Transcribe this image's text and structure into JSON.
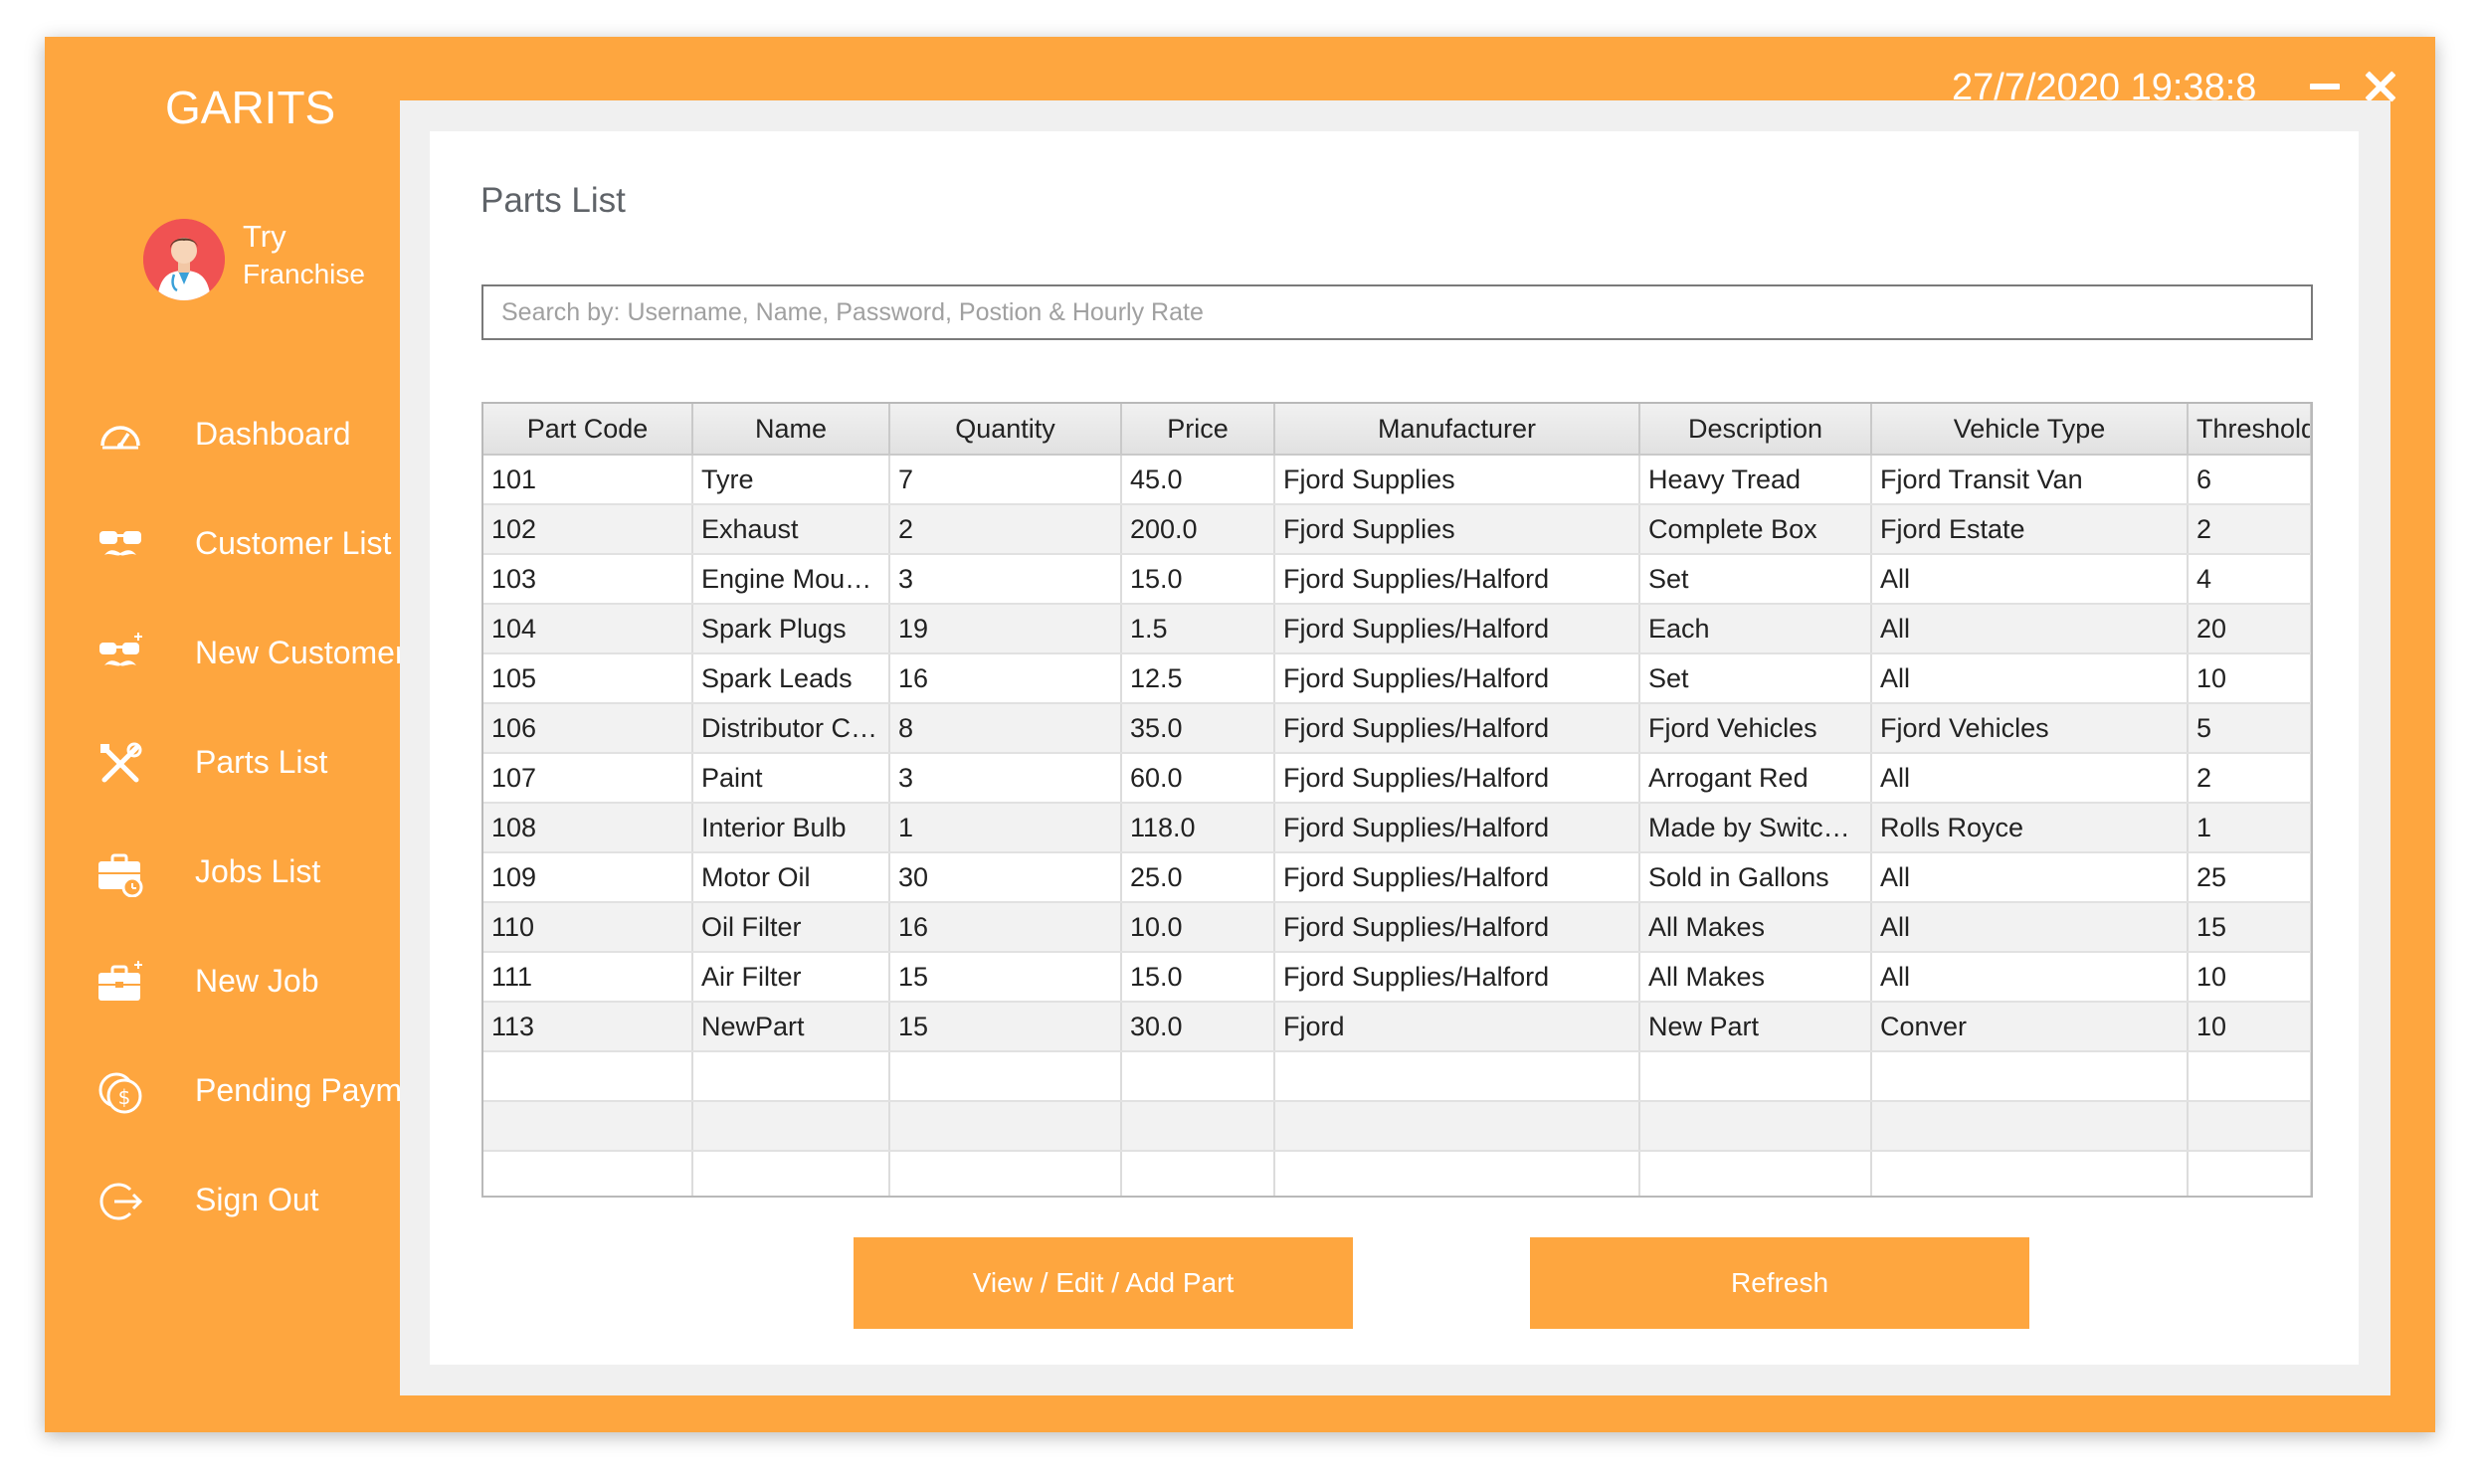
{
  "app": {
    "title": "GARITS",
    "datetime": "27/7/2020 19:38:8"
  },
  "user": {
    "name": "Try",
    "role": "Franchise"
  },
  "colors": {
    "accent": "#fea63f",
    "panel": "#ffffff",
    "content_bg": "#f0f0f0"
  },
  "sidebar": {
    "items": [
      {
        "label": "Dashboard",
        "icon": "dashboard-icon"
      },
      {
        "label": "Customer List",
        "icon": "mustache-glasses-icon"
      },
      {
        "label": "New Customer",
        "icon": "mustache-glasses-plus-icon"
      },
      {
        "label": "Parts List",
        "icon": "tools-icon"
      },
      {
        "label": "Jobs List",
        "icon": "briefcase-clock-icon"
      },
      {
        "label": "New Job",
        "icon": "briefcase-plus-icon"
      },
      {
        "label": "Pending Payment",
        "icon": "coins-icon"
      },
      {
        "label": "Sign Out",
        "icon": "sign-out-icon"
      }
    ]
  },
  "main": {
    "title": "Parts List",
    "search": {
      "placeholder": "Search by: Username, Name, Password, Postion & Hourly Rate",
      "value": ""
    },
    "table": {
      "columns": [
        "Part Code",
        "Name",
        "Quantity",
        "Price",
        "Manufacturer",
        "Description",
        "Vehicle Type",
        "Threshold"
      ],
      "rows": [
        [
          "101",
          "Tyre",
          "7",
          "45.0",
          "Fjord Supplies",
          "Heavy Tread",
          "Fjord Transit Van",
          "6"
        ],
        [
          "102",
          "Exhaust",
          "2",
          "200.0",
          "Fjord Supplies",
          "Complete Box",
          "Fjord Estate",
          "2"
        ],
        [
          "103",
          "Engine Mounts",
          "3",
          "15.0",
          "Fjord Supplies/Halford",
          "Set",
          "All",
          "4"
        ],
        [
          "104",
          "Spark Plugs",
          "19",
          "1.5",
          "Fjord Supplies/Halford",
          "Each",
          "All",
          "20"
        ],
        [
          "105",
          "Spark Leads",
          "16",
          "12.5",
          "Fjord Supplies/Halford",
          "Set",
          "All",
          "10"
        ],
        [
          "106",
          "Distributor Cap",
          "8",
          "35.0",
          "Fjord Supplies/Halford",
          "Fjord Vehicles",
          "Fjord Vehicles",
          "5"
        ],
        [
          "107",
          "Paint",
          "3",
          "60.0",
          "Fjord Supplies/Halford",
          "Arrogant Red",
          "All",
          "2"
        ],
        [
          "108",
          "Interior Bulb",
          "1",
          "118.0",
          "Fjord Supplies/Halford",
          "Made by Switch-I...",
          "Rolls Royce",
          "1"
        ],
        [
          "109",
          "Motor Oil",
          "30",
          "25.0",
          "Fjord Supplies/Halford",
          "Sold in Gallons",
          "All",
          "25"
        ],
        [
          "110",
          "Oil Filter",
          "16",
          "10.0",
          "Fjord Supplies/Halford",
          "All Makes",
          "All",
          "15"
        ],
        [
          "111",
          "Air Filter",
          "15",
          "15.0",
          "Fjord Supplies/Halford",
          "All Makes",
          "All",
          "10"
        ],
        [
          "113",
          "NewPart",
          "15",
          "30.0",
          "Fjord",
          "New Part",
          "Conver",
          "10"
        ]
      ],
      "empty_rows": 3
    },
    "buttons": {
      "view_edit_add": "View / Edit / Add Part",
      "refresh": "Refresh"
    }
  }
}
